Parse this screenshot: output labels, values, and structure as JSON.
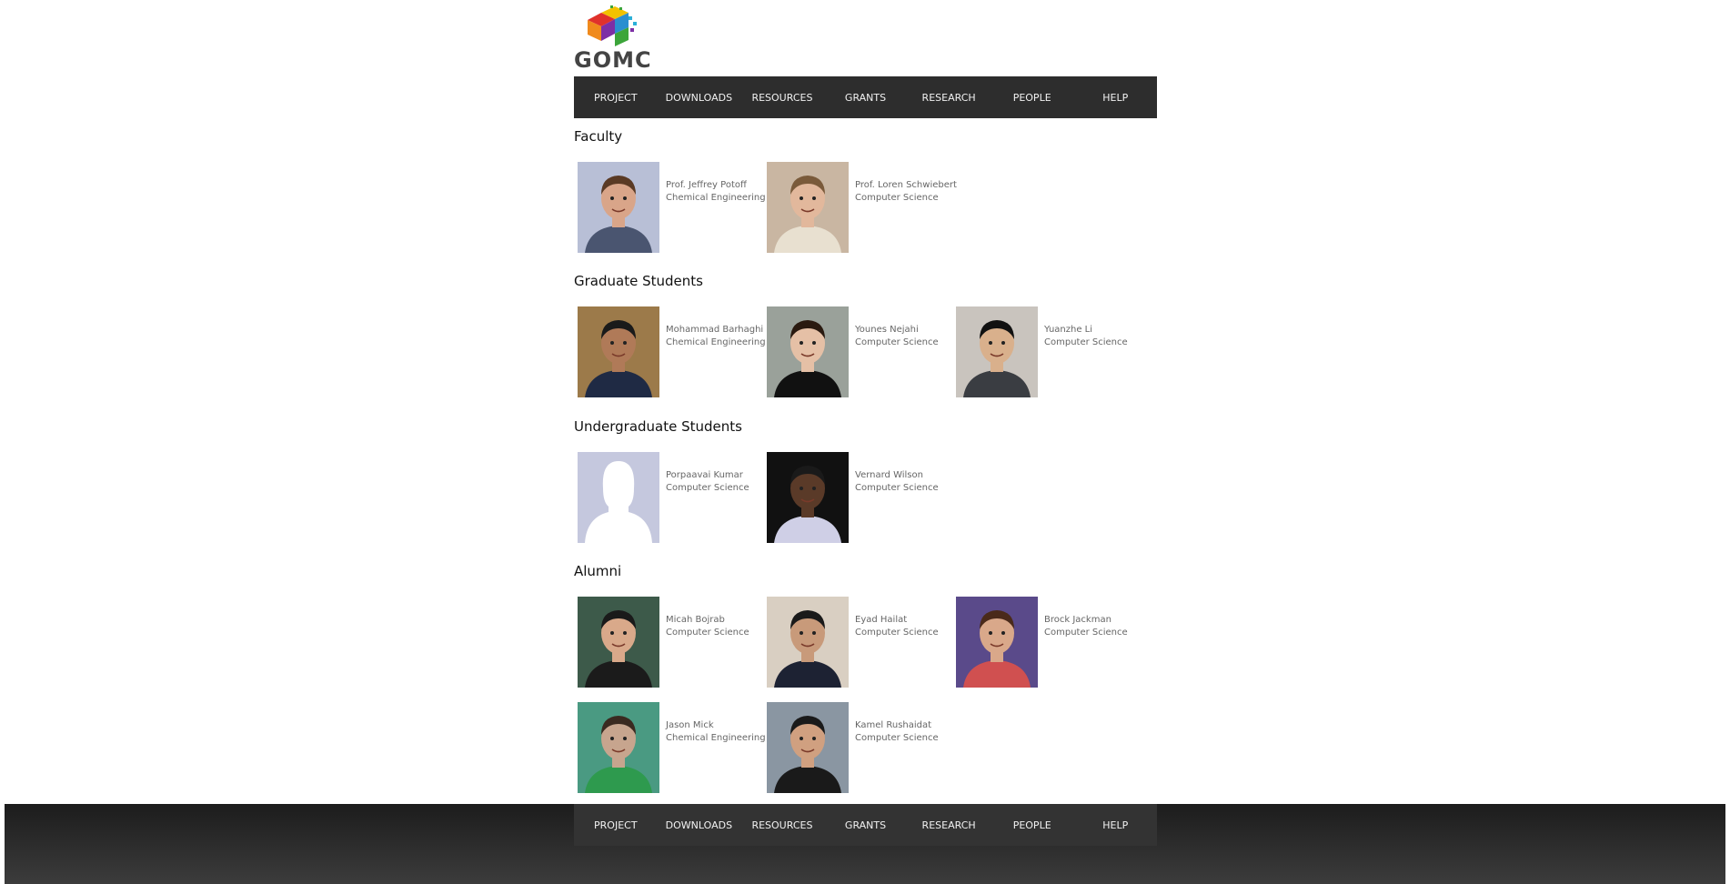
{
  "site": {
    "logo_text": "GOMC"
  },
  "nav": {
    "items": [
      {
        "label": "PROJECT"
      },
      {
        "label": "DOWNLOADS"
      },
      {
        "label": "RESOURCES"
      },
      {
        "label": "GRANTS"
      },
      {
        "label": "RESEARCH"
      },
      {
        "label": "PEOPLE"
      },
      {
        "label": "HELP"
      }
    ]
  },
  "sections": {
    "faculty": {
      "title": "Faculty",
      "people": [
        {
          "name": "Prof. Jeffrey Potoff",
          "dept": "Chemical Engineering"
        },
        {
          "name": "Prof. Loren Schwiebert",
          "dept": "Computer Science"
        }
      ]
    },
    "graduate": {
      "title": "Graduate Students",
      "people": [
        {
          "name": "Mohammad Barhaghi",
          "dept": "Chemical Engineering"
        },
        {
          "name": "Younes Nejahi",
          "dept": "Computer Science"
        },
        {
          "name": "Yuanzhe Li",
          "dept": "Computer Science"
        }
      ]
    },
    "undergraduate": {
      "title": "Undergraduate Students",
      "people": [
        {
          "name": "Porpaavai Kumar",
          "dept": "Computer Science"
        },
        {
          "name": "Vernard Wilson",
          "dept": "Computer Science"
        }
      ]
    },
    "alumni": {
      "title": "Alumni",
      "people": [
        {
          "name": "Micah Bojrab",
          "dept": "Computer Science"
        },
        {
          "name": "Eyad Hailat",
          "dept": "Computer Science"
        },
        {
          "name": "Brock Jackman",
          "dept": "Computer Science"
        },
        {
          "name": "Jason Mick",
          "dept": "Chemical Engineering"
        },
        {
          "name": "Kamel Rushaidat",
          "dept": "Computer Science"
        }
      ]
    }
  },
  "footer_nav": {
    "items": [
      {
        "label": "PROJECT"
      },
      {
        "label": "DOWNLOADS"
      },
      {
        "label": "RESOURCES"
      },
      {
        "label": "GRANTS"
      },
      {
        "label": "RESEARCH"
      },
      {
        "label": "PEOPLE"
      },
      {
        "label": "HELP"
      }
    ]
  },
  "colors": {
    "nav_bg": "#2d2d2d",
    "footer_bg": "#2a2a2a",
    "text_muted": "#666666"
  },
  "photos": [
    {
      "icon": "person-photo",
      "bg": "#b8bfd6",
      "skin": "#d9a589",
      "shirt": "#4a5570",
      "hair": "#5a3a24"
    },
    {
      "icon": "person-photo",
      "bg": "#c9b6a2",
      "skin": "#e2b89c",
      "shirt": "#e8e0d0",
      "hair": "#7a5a3a"
    },
    {
      "icon": "person-photo",
      "bg": "#9c7a4a",
      "skin": "#b07a58",
      "shirt": "#1f2a44",
      "hair": "#1a1a1a"
    },
    {
      "icon": "person-photo",
      "bg": "#9aa19a",
      "skin": "#e5c0a6",
      "shirt": "#111111",
      "hair": "#2a1a10"
    },
    {
      "icon": "person-photo",
      "bg": "#c9c4be",
      "skin": "#d9b08c",
      "shirt": "#3a3d42",
      "hair": "#111111"
    },
    {
      "icon": "placeholder-avatar",
      "bg": "#c5c8de",
      "skin": "#ffffff",
      "shirt": "#ffffff",
      "hair": "#ffffff"
    },
    {
      "icon": "person-photo",
      "bg": "#111111",
      "skin": "#5a3a28",
      "shirt": "#cfcfe6",
      "hair": "#1a1a1a"
    },
    {
      "icon": "person-photo",
      "bg": "#3d5a4a",
      "skin": "#d9a98a",
      "shirt": "#1b1b1b",
      "hair": "#1a1a1a"
    },
    {
      "icon": "person-photo",
      "bg": "#d9cfc2",
      "skin": "#c89a7a",
      "shirt": "#1d2233",
      "hair": "#1a1a1a"
    },
    {
      "icon": "person-photo",
      "bg": "#5a4a8a",
      "skin": "#d9a88a",
      "shirt": "#d05050",
      "hair": "#4a2a1a"
    },
    {
      "icon": "person-photo",
      "bg": "#4a9a82",
      "skin": "#c7a58e",
      "shirt": "#2e9a4e",
      "hair": "#3a2a20"
    },
    {
      "icon": "person-photo",
      "bg": "#8a96a2",
      "skin": "#d0a080",
      "shirt": "#1a1a1a",
      "hair": "#1a1a1a"
    }
  ]
}
